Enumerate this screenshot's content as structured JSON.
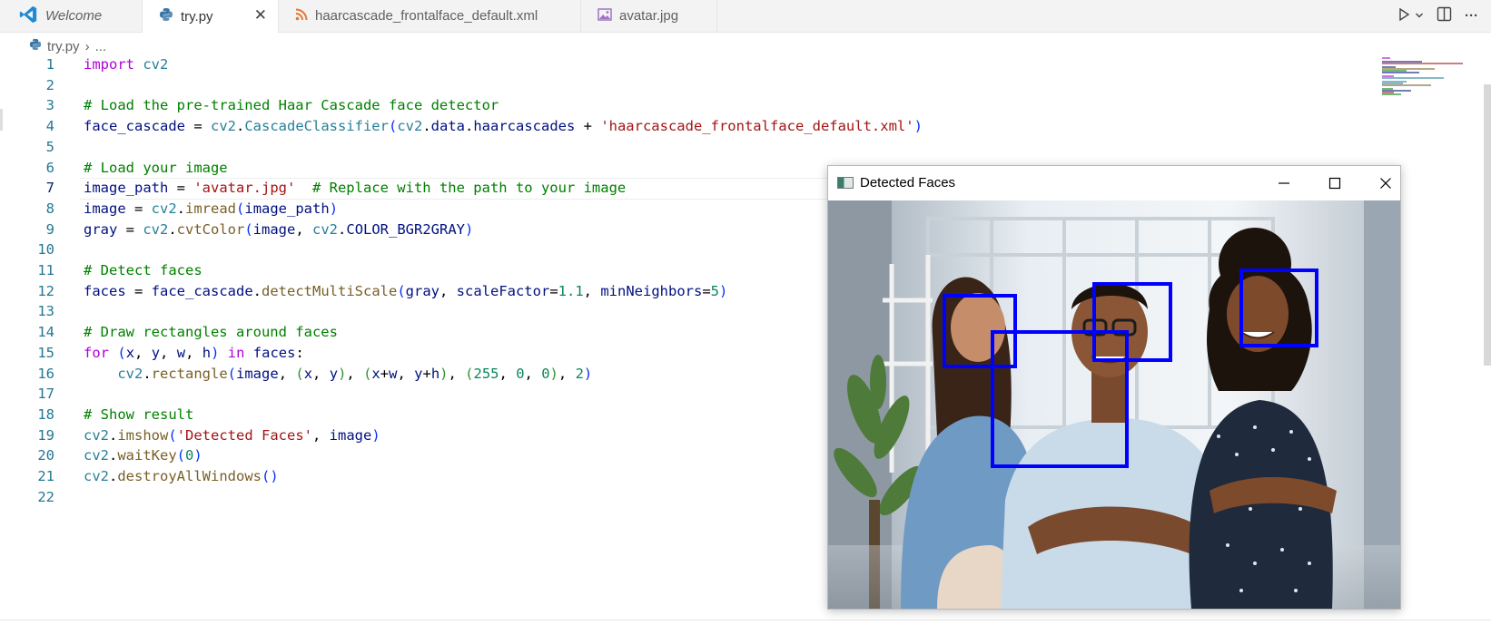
{
  "tabs": [
    {
      "label": "Welcome",
      "icon": "vscode-logo-icon"
    },
    {
      "label": "try.py",
      "icon": "python-file-icon",
      "active": true
    },
    {
      "label": "haarcascade_frontalface_default.xml",
      "icon": "rss-xml-file-icon"
    },
    {
      "label": "avatar.jpg",
      "icon": "image-file-icon"
    }
  ],
  "title_actions": {
    "run": "run-icon",
    "run_menu": "chevron-down-icon",
    "split": "split-editor-icon",
    "more": "more-icon"
  },
  "breadcrumb": {
    "file": "try.py",
    "rest": "..."
  },
  "editor": {
    "active_line": 7,
    "line_numbers": [
      "1",
      "2",
      "3",
      "4",
      "5",
      "6",
      "7",
      "8",
      "9",
      "10",
      "11",
      "12",
      "13",
      "14",
      "15",
      "16",
      "17",
      "18",
      "19",
      "20",
      "21",
      "22"
    ]
  },
  "colors": {
    "keyword": "#af00db",
    "module": "#267f99",
    "variable": "#001080",
    "function": "#795e26",
    "string": "#a31515",
    "comment": "#008000",
    "number": "#098658",
    "line_number": "#237893",
    "face_box": "#0000ff"
  },
  "code_lines": [
    [
      [
        "kw",
        "import"
      ],
      [
        "op",
        " "
      ],
      [
        "mod",
        "cv2"
      ]
    ],
    [],
    [
      [
        "cm",
        "# Load the pre-trained Haar Cascade face detector"
      ]
    ],
    [
      [
        "var",
        "face_cascade"
      ],
      [
        "op",
        " = "
      ],
      [
        "mod",
        "cv2"
      ],
      [
        "op",
        "."
      ],
      [
        "mod",
        "CascadeClassifier"
      ],
      [
        "p1",
        "("
      ],
      [
        "mod",
        "cv2"
      ],
      [
        "op",
        "."
      ],
      [
        "var",
        "data"
      ],
      [
        "op",
        "."
      ],
      [
        "var",
        "haarcascades"
      ],
      [
        "op",
        " + "
      ],
      [
        "str",
        "'haarcascade_frontalface_default.xml'"
      ],
      [
        "p1",
        ")"
      ]
    ],
    [],
    [
      [
        "cm",
        "# Load your image"
      ]
    ],
    [
      [
        "var",
        "image_path"
      ],
      [
        "op",
        " = "
      ],
      [
        "str",
        "'avatar.jpg'"
      ],
      [
        "op",
        "  "
      ],
      [
        "cm",
        "# Replace with the path to your image"
      ]
    ],
    [
      [
        "var",
        "image"
      ],
      [
        "op",
        " = "
      ],
      [
        "mod",
        "cv2"
      ],
      [
        "op",
        "."
      ],
      [
        "fn",
        "imread"
      ],
      [
        "p1",
        "("
      ],
      [
        "var",
        "image_path"
      ],
      [
        "p1",
        ")"
      ]
    ],
    [
      [
        "var",
        "gray"
      ],
      [
        "op",
        " = "
      ],
      [
        "mod",
        "cv2"
      ],
      [
        "op",
        "."
      ],
      [
        "fn",
        "cvtColor"
      ],
      [
        "p1",
        "("
      ],
      [
        "var",
        "image"
      ],
      [
        "op",
        ", "
      ],
      [
        "mod",
        "cv2"
      ],
      [
        "op",
        "."
      ],
      [
        "var",
        "COLOR_BGR2GRAY"
      ],
      [
        "p1",
        ")"
      ]
    ],
    [],
    [
      [
        "cm",
        "# Detect faces"
      ]
    ],
    [
      [
        "var",
        "faces"
      ],
      [
        "op",
        " = "
      ],
      [
        "var",
        "face_cascade"
      ],
      [
        "op",
        "."
      ],
      [
        "fn",
        "detectMultiScale"
      ],
      [
        "p1",
        "("
      ],
      [
        "var",
        "gray"
      ],
      [
        "op",
        ", "
      ],
      [
        "var",
        "scaleFactor"
      ],
      [
        "op",
        "="
      ],
      [
        "num",
        "1.1"
      ],
      [
        "op",
        ", "
      ],
      [
        "var",
        "minNeighbors"
      ],
      [
        "op",
        "="
      ],
      [
        "num",
        "5"
      ],
      [
        "p1",
        ")"
      ]
    ],
    [],
    [
      [
        "cm",
        "# Draw rectangles around faces"
      ]
    ],
    [
      [
        "kw",
        "for"
      ],
      [
        "op",
        " "
      ],
      [
        "p1",
        "("
      ],
      [
        "var",
        "x"
      ],
      [
        "op",
        ", "
      ],
      [
        "var",
        "y"
      ],
      [
        "op",
        ", "
      ],
      [
        "var",
        "w"
      ],
      [
        "op",
        ", "
      ],
      [
        "var",
        "h"
      ],
      [
        "p1",
        ")"
      ],
      [
        "op",
        " "
      ],
      [
        "kw",
        "in"
      ],
      [
        "op",
        " "
      ],
      [
        "var",
        "faces"
      ],
      [
        "op",
        ":"
      ]
    ],
    [
      [
        "ws",
        "    "
      ],
      [
        "mod",
        "cv2"
      ],
      [
        "op",
        "."
      ],
      [
        "fn",
        "rectangle"
      ],
      [
        "p1",
        "("
      ],
      [
        "var",
        "image"
      ],
      [
        "op",
        ", "
      ],
      [
        "p2",
        "("
      ],
      [
        "var",
        "x"
      ],
      [
        "op",
        ", "
      ],
      [
        "var",
        "y"
      ],
      [
        "p2",
        ")"
      ],
      [
        "op",
        ", "
      ],
      [
        "p2",
        "("
      ],
      [
        "var",
        "x"
      ],
      [
        "op",
        "+"
      ],
      [
        "var",
        "w"
      ],
      [
        "op",
        ", "
      ],
      [
        "var",
        "y"
      ],
      [
        "op",
        "+"
      ],
      [
        "var",
        "h"
      ],
      [
        "p2",
        ")"
      ],
      [
        "op",
        ", "
      ],
      [
        "p2",
        "("
      ],
      [
        "num",
        "255"
      ],
      [
        "op",
        ", "
      ],
      [
        "num",
        "0"
      ],
      [
        "op",
        ", "
      ],
      [
        "num",
        "0"
      ],
      [
        "p2",
        ")"
      ],
      [
        "op",
        ", "
      ],
      [
        "num",
        "2"
      ],
      [
        "p1",
        ")"
      ]
    ],
    [],
    [
      [
        "cm",
        "# Show result"
      ]
    ],
    [
      [
        "mod",
        "cv2"
      ],
      [
        "op",
        "."
      ],
      [
        "fn",
        "imshow"
      ],
      [
        "p1",
        "("
      ],
      [
        "str",
        "'Detected Faces'"
      ],
      [
        "op",
        ", "
      ],
      [
        "var",
        "image"
      ],
      [
        "p1",
        ")"
      ]
    ],
    [
      [
        "mod",
        "cv2"
      ],
      [
        "op",
        "."
      ],
      [
        "fn",
        "waitKey"
      ],
      [
        "p1",
        "("
      ],
      [
        "num",
        "0"
      ],
      [
        "p1",
        ")"
      ]
    ],
    [
      [
        "mod",
        "cv2"
      ],
      [
        "op",
        "."
      ],
      [
        "fn",
        "destroyAllWindows"
      ],
      [
        "p1",
        "("
      ],
      [
        "p1",
        ")"
      ]
    ],
    []
  ],
  "cv_window": {
    "title": "Detected Faces",
    "icon": "opencv-window-icon",
    "buttons": {
      "minimize": "minimize-icon",
      "maximize": "maximize-icon",
      "close": "close-icon"
    },
    "face_count": 4
  }
}
